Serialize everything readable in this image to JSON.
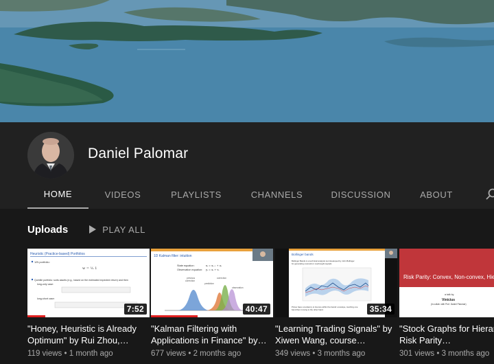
{
  "channel": {
    "name": "Daniel Palomar"
  },
  "tabs": [
    {
      "label": "HOME",
      "active": true
    },
    {
      "label": "VIDEOS",
      "active": false
    },
    {
      "label": "PLAYLISTS",
      "active": false
    },
    {
      "label": "CHANNELS",
      "active": false
    },
    {
      "label": "DISCUSSION",
      "active": false
    },
    {
      "label": "ABOUT",
      "active": false
    }
  ],
  "uploads": {
    "title": "Uploads",
    "play_all_label": "PLAY ALL"
  },
  "videos": [
    {
      "title": "\"Honey, Heuristic is Already Optimum\" by Rui Zhou,…",
      "views": "119 views",
      "age": "1 month ago",
      "duration": "7:52",
      "thumb_title": "Heuristic (Practice-based) Portfolios",
      "thumb_lines": [
        "1/N portfolio:",
        "Quintile portfolio: sorts assets (e.g., based on the estimated expected return) and then",
        "long-only case:",
        "long-short case:"
      ],
      "progress": 0.15
    },
    {
      "title": "\"Kalman Filtering with Applications in Finance\" by…",
      "views": "677 views",
      "age": "2 months ago",
      "duration": "40:47",
      "thumb_title": "1D Kalman filter: intuition",
      "thumb_lines": [
        "State equation:",
        "Observation equation:",
        "previous",
        "correction",
        "prediction",
        "observation",
        "correction"
      ],
      "progress": 0.38
    },
    {
      "title": "\"Learning Trading Signals\" by Xiwen Wang, course…",
      "views": "349 views",
      "age": "3 months ago",
      "duration": "35:34",
      "thumb_title": "Bollinger bands",
      "thumb_lines": [
        "Bollinger Bands is a technical analysis tool developed by John Bollinger",
        "for generating oversold or overbought signals:",
        "Prices have a tendency to bounce within the bands' envelope, touching one",
        "band then moving to the other band."
      ],
      "progress": 0.0
    },
    {
      "title": "\"Stock Graphs for Hierarchical Risk Parity…",
      "views": "301 views",
      "age": "3 months ago",
      "duration": "",
      "thumb_title": "Risk Parity: Convex, Non-convex, Hierarchical Models",
      "thumb_lines": [
        "a talk by",
        "Vinícius",
        "(in collab. with Prof. Daniel Palomar)"
      ],
      "progress": 0.0
    }
  ]
}
